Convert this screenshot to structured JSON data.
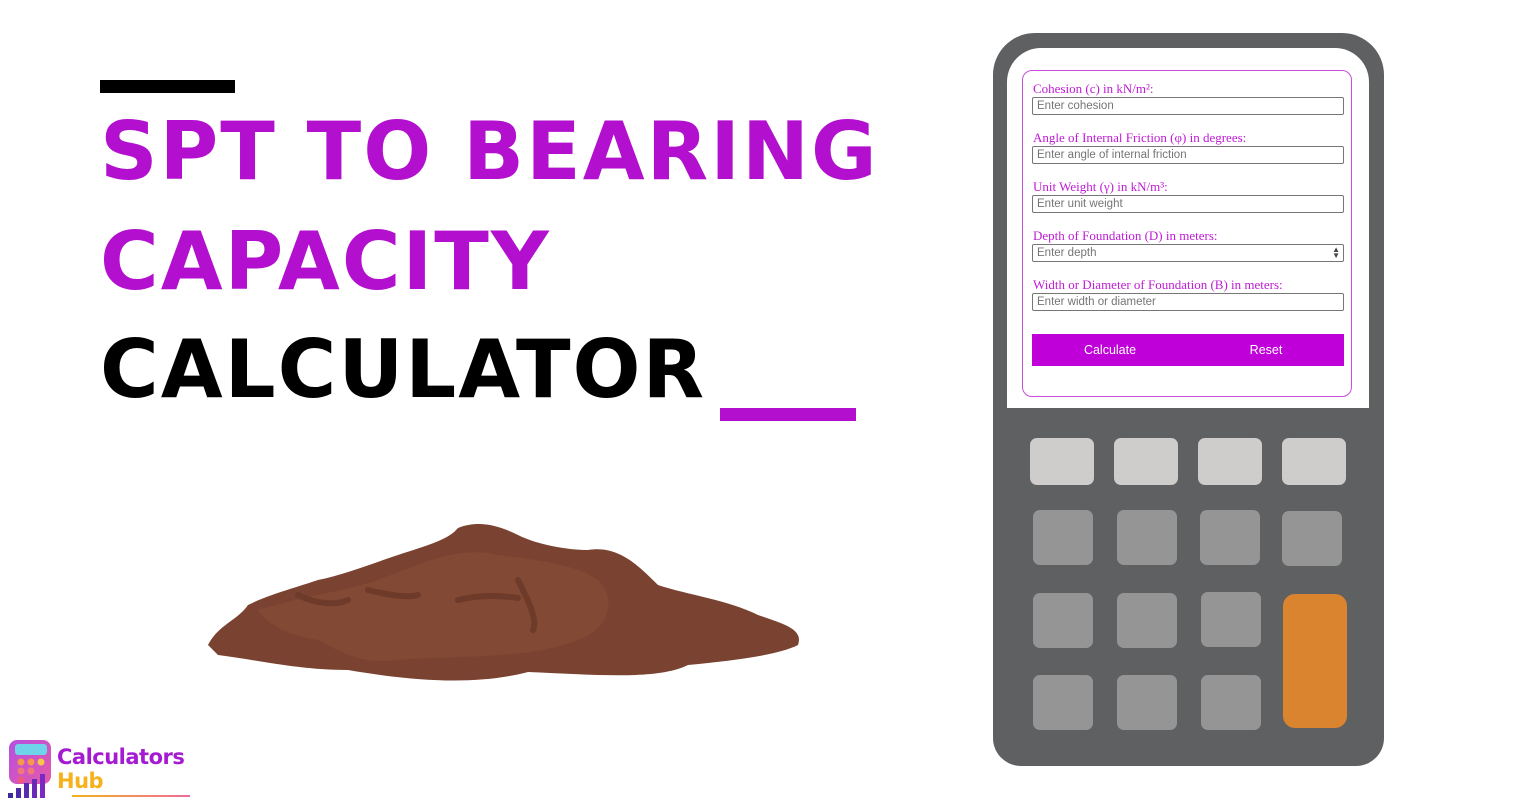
{
  "banner": {
    "title_line_1": "SPT TO BEARING",
    "title_line_2": "CAPACITY",
    "title_line_3": "CALCULATOR",
    "accent_color": "#b30fcf",
    "dark_color": "#000000"
  },
  "form": {
    "fields": [
      {
        "label": "Cohesion (c) in kN/m²:",
        "placeholder": "Enter cohesion",
        "value": ""
      },
      {
        "label": "Angle of Internal Friction (φ) in degrees:",
        "placeholder": "Enter angle of internal friction",
        "value": ""
      },
      {
        "label": "Unit Weight (γ) in kN/m³:",
        "placeholder": "Enter unit weight",
        "value": ""
      },
      {
        "label": "Depth of Foundation (D) in meters:",
        "placeholder": "Enter depth",
        "value": ""
      },
      {
        "label": "Width or Diameter of Foundation (B) in meters:",
        "placeholder": "Enter width or diameter",
        "value": ""
      }
    ],
    "calculate_label": "Calculate",
    "reset_label": "Reset",
    "button_color": "#c000d8",
    "label_color": "#c01ad6"
  },
  "calculator_graphic": {
    "body_color": "#5f6062",
    "top_key_color": "#cfcdcb",
    "key_color": "#959595",
    "equals_key_color": "#db8430"
  },
  "logo": {
    "line_1": "Calculators",
    "line_2": "Hub"
  },
  "icons": {
    "soil": "soil-pile-icon",
    "logo": "calculator-chart-logo-icon",
    "spinner": "number-spinner-icon"
  }
}
